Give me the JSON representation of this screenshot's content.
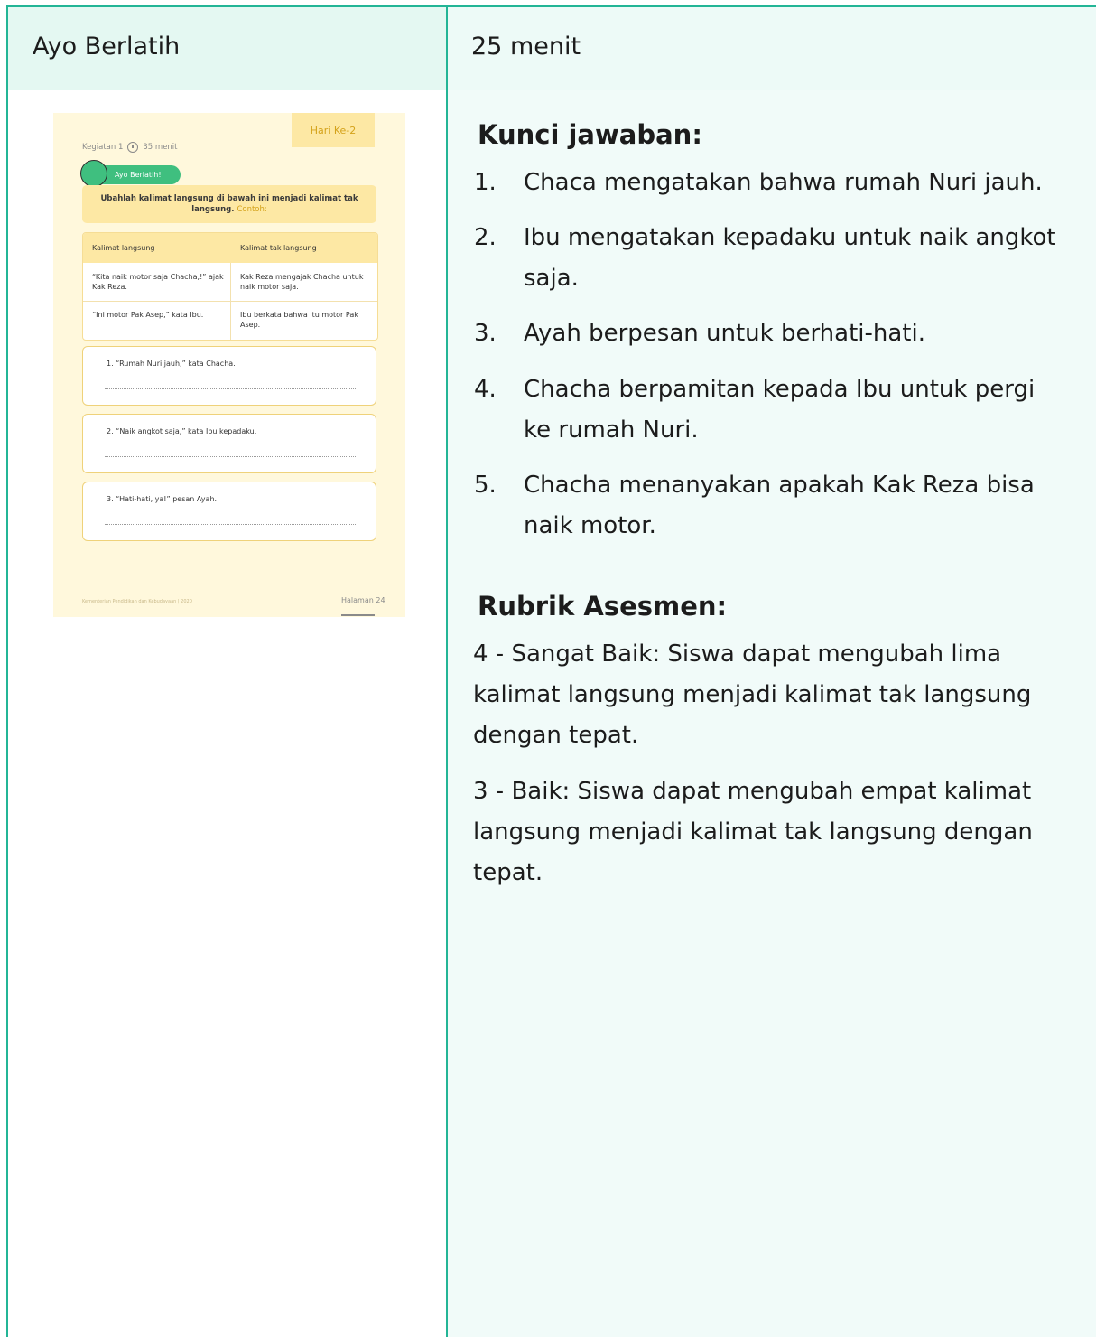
{
  "header": {
    "activity": "Ayo Berlatih",
    "duration": "25 menit"
  },
  "worksheet": {
    "day_tab": "Hari Ke-2",
    "activity_label": "Kegiatan 1",
    "time": "35 menit",
    "pill": "Ayo Berlatih!",
    "instruction": "Ubahlah kalimat langsung di bawah ini menjadi kalimat tak langsung.",
    "instruction_hint": "Contoh:",
    "table_headers": [
      "Kalimat langsung",
      "Kalimat tak langsung"
    ],
    "rows": [
      [
        "“Kita naik motor saja Chacha,!” ajak Kak Reza.",
        "Kak Reza mengajak Chacha untuk naik motor saja."
      ],
      [
        "“Ini motor Pak Asep,” kata Ibu.",
        "Ibu berkata bahwa itu motor Pak Asep."
      ]
    ],
    "questions": [
      "1. “Rumah Nuri jauh,” kata Chacha.",
      "2. “Naik angkot saja,” kata Ibu kepadaku.",
      "3. “Hati-hati, ya!” pesan Ayah."
    ],
    "footer": "Kementerian Pendidikan dan Kebudayaan | 2020",
    "page": "Halaman 24"
  },
  "answers": {
    "title": "Kunci jawaban:",
    "items": [
      {
        "num": "1.",
        "text": "Chaca mengatakan bahwa rumah Nuri jauh."
      },
      {
        "num": "2.",
        "text": "Ibu mengatakan kepadaku untuk naik angkot saja."
      },
      {
        "num": "3.",
        "text": "Ayah berpesan untuk berhati-hati."
      },
      {
        "num": "4.",
        "text": "Chacha berpamitan kepada Ibu untuk pergi ke rumah Nuri."
      },
      {
        "num": "5.",
        "text": "Chacha menanyakan apakah Kak Reza bisa naik motor."
      }
    ]
  },
  "rubric": {
    "title": "Rubrik Asesmen:",
    "levels": [
      "4 - Sangat Baik: Siswa dapat mengubah lima kalimat langsung menjadi kalimat tak langsung dengan tepat.",
      "3 - Baik: Siswa dapat mengubah empat kalimat langsung menjadi kalimat tak langsung dengan tepat."
    ]
  }
}
